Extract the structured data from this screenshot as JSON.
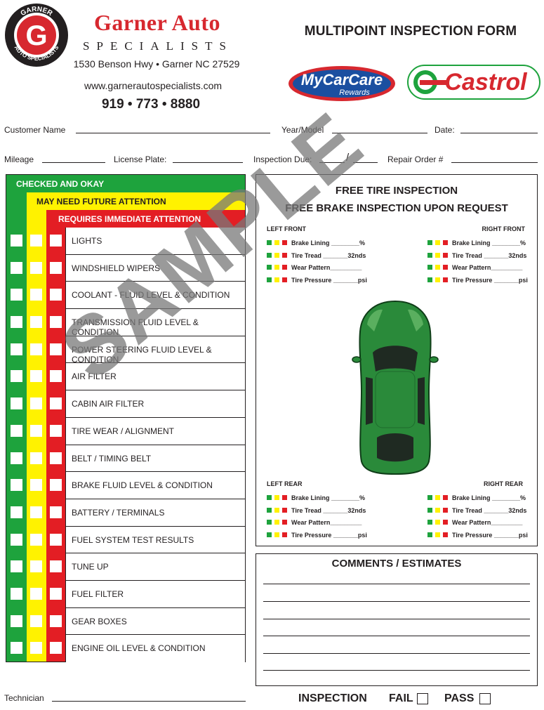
{
  "header": {
    "badge_top_text": "GARNER",
    "badge_bottom_text": "AUTO SPECIALISTS",
    "badge_letter": "G",
    "brand_name": "Garner Auto",
    "brand_sub": "SPECIALISTS",
    "address": "1530 Benson Hwy • Garner NC 27529",
    "website": "www.garnerautospecialists.com",
    "phone": "919 • 773 • 8880",
    "form_title": "MULTIPOINT INSPECTION FORM",
    "mycarcare_text": "MyCarCare",
    "mycarcare_sub": "Rewards",
    "castrol_text": "Castrol"
  },
  "fields": {
    "customer_name": "Customer Name",
    "year_model": "Year/Model",
    "date": "Date:",
    "mileage": "Mileage",
    "license_plate": "License Plate:",
    "inspection_due": "Inspection Due:",
    "due_separator": "/",
    "repair_order": "Repair Order #"
  },
  "checklist": {
    "header_green": "CHECKED AND OKAY",
    "header_yellow": "MAY NEED FUTURE ATTENTION",
    "header_red": "REQUIRES IMMEDIATE ATTENTION",
    "items": [
      "LIGHTS",
      "WINDSHIELD WIPERS",
      "COOLANT  - FLUID LEVEL & CONDITION",
      "TRANSMISSION FLUID LEVEL & CONDITION",
      "POWER STEERING FLUID LEVEL & CONDITION",
      "AIR FILTER",
      "CABIN AIR FILTER",
      "TIRE WEAR / ALIGNMENT",
      "BELT / TIMING BELT",
      "BRAKE FLUID LEVEL & CONDITION",
      "BATTERY / TERMINALS",
      "FUEL SYSTEM TEST RESULTS",
      "TUNE UP",
      "FUEL FILTER",
      "GEAR BOXES",
      "ENGINE OIL LEVEL & CONDITION"
    ]
  },
  "tire_panel": {
    "title1": "FREE TIRE INSPECTION",
    "title2": "FREE BRAKE INSPECTION UPON REQUEST",
    "corners": {
      "left_front": "LEFT FRONT",
      "right_front": "RIGHT FRONT",
      "left_rear": "LEFT REAR",
      "right_rear": "RIGHT REAR"
    },
    "measurements": [
      "Brake Lining ________%",
      "Tire Tread _______32nds",
      "Wear Pattern_________",
      "Tire Pressure _______psi"
    ]
  },
  "comments": {
    "title": "COMMENTS / ESTIMATES"
  },
  "footer": {
    "technician": "Technician",
    "inspection": "INSPECTION",
    "fail": "FAIL",
    "pass": "PASS"
  },
  "watermark": "SAMPLE",
  "colors": {
    "green": "#1ea33d",
    "yellow": "#fff200",
    "red": "#e31e24",
    "brand_red": "#d7282f",
    "car_green": "#2a8a3a"
  }
}
